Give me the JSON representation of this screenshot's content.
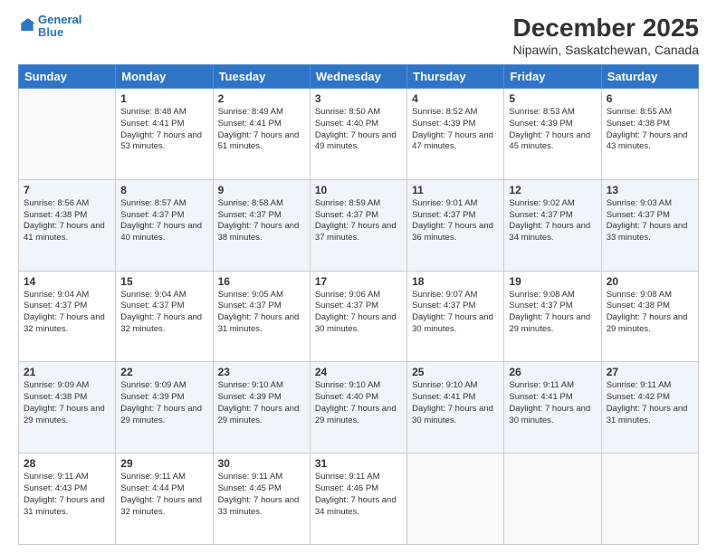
{
  "header": {
    "logo_line1": "General",
    "logo_line2": "Blue",
    "title": "December 2025",
    "subtitle": "Nipawin, Saskatchewan, Canada"
  },
  "weekdays": [
    "Sunday",
    "Monday",
    "Tuesday",
    "Wednesday",
    "Thursday",
    "Friday",
    "Saturday"
  ],
  "weeks": [
    [
      {
        "day": "",
        "sunrise": "",
        "sunset": "",
        "daylight": ""
      },
      {
        "day": "1",
        "sunrise": "Sunrise: 8:48 AM",
        "sunset": "Sunset: 4:41 PM",
        "daylight": "Daylight: 7 hours and 53 minutes."
      },
      {
        "day": "2",
        "sunrise": "Sunrise: 8:49 AM",
        "sunset": "Sunset: 4:41 PM",
        "daylight": "Daylight: 7 hours and 51 minutes."
      },
      {
        "day": "3",
        "sunrise": "Sunrise: 8:50 AM",
        "sunset": "Sunset: 4:40 PM",
        "daylight": "Daylight: 7 hours and 49 minutes."
      },
      {
        "day": "4",
        "sunrise": "Sunrise: 8:52 AM",
        "sunset": "Sunset: 4:39 PM",
        "daylight": "Daylight: 7 hours and 47 minutes."
      },
      {
        "day": "5",
        "sunrise": "Sunrise: 8:53 AM",
        "sunset": "Sunset: 4:39 PM",
        "daylight": "Daylight: 7 hours and 45 minutes."
      },
      {
        "day": "6",
        "sunrise": "Sunrise: 8:55 AM",
        "sunset": "Sunset: 4:38 PM",
        "daylight": "Daylight: 7 hours and 43 minutes."
      }
    ],
    [
      {
        "day": "7",
        "sunrise": "Sunrise: 8:56 AM",
        "sunset": "Sunset: 4:38 PM",
        "daylight": "Daylight: 7 hours and 41 minutes."
      },
      {
        "day": "8",
        "sunrise": "Sunrise: 8:57 AM",
        "sunset": "Sunset: 4:37 PM",
        "daylight": "Daylight: 7 hours and 40 minutes."
      },
      {
        "day": "9",
        "sunrise": "Sunrise: 8:58 AM",
        "sunset": "Sunset: 4:37 PM",
        "daylight": "Daylight: 7 hours and 38 minutes."
      },
      {
        "day": "10",
        "sunrise": "Sunrise: 8:59 AM",
        "sunset": "Sunset: 4:37 PM",
        "daylight": "Daylight: 7 hours and 37 minutes."
      },
      {
        "day": "11",
        "sunrise": "Sunrise: 9:01 AM",
        "sunset": "Sunset: 4:37 PM",
        "daylight": "Daylight: 7 hours and 36 minutes."
      },
      {
        "day": "12",
        "sunrise": "Sunrise: 9:02 AM",
        "sunset": "Sunset: 4:37 PM",
        "daylight": "Daylight: 7 hours and 34 minutes."
      },
      {
        "day": "13",
        "sunrise": "Sunrise: 9:03 AM",
        "sunset": "Sunset: 4:37 PM",
        "daylight": "Daylight: 7 hours and 33 minutes."
      }
    ],
    [
      {
        "day": "14",
        "sunrise": "Sunrise: 9:04 AM",
        "sunset": "Sunset: 4:37 PM",
        "daylight": "Daylight: 7 hours and 32 minutes."
      },
      {
        "day": "15",
        "sunrise": "Sunrise: 9:04 AM",
        "sunset": "Sunset: 4:37 PM",
        "daylight": "Daylight: 7 hours and 32 minutes."
      },
      {
        "day": "16",
        "sunrise": "Sunrise: 9:05 AM",
        "sunset": "Sunset: 4:37 PM",
        "daylight": "Daylight: 7 hours and 31 minutes."
      },
      {
        "day": "17",
        "sunrise": "Sunrise: 9:06 AM",
        "sunset": "Sunset: 4:37 PM",
        "daylight": "Daylight: 7 hours and 30 minutes."
      },
      {
        "day": "18",
        "sunrise": "Sunrise: 9:07 AM",
        "sunset": "Sunset: 4:37 PM",
        "daylight": "Daylight: 7 hours and 30 minutes."
      },
      {
        "day": "19",
        "sunrise": "Sunrise: 9:08 AM",
        "sunset": "Sunset: 4:37 PM",
        "daylight": "Daylight: 7 hours and 29 minutes."
      },
      {
        "day": "20",
        "sunrise": "Sunrise: 9:08 AM",
        "sunset": "Sunset: 4:38 PM",
        "daylight": "Daylight: 7 hours and 29 minutes."
      }
    ],
    [
      {
        "day": "21",
        "sunrise": "Sunrise: 9:09 AM",
        "sunset": "Sunset: 4:38 PM",
        "daylight": "Daylight: 7 hours and 29 minutes."
      },
      {
        "day": "22",
        "sunrise": "Sunrise: 9:09 AM",
        "sunset": "Sunset: 4:39 PM",
        "daylight": "Daylight: 7 hours and 29 minutes."
      },
      {
        "day": "23",
        "sunrise": "Sunrise: 9:10 AM",
        "sunset": "Sunset: 4:39 PM",
        "daylight": "Daylight: 7 hours and 29 minutes."
      },
      {
        "day": "24",
        "sunrise": "Sunrise: 9:10 AM",
        "sunset": "Sunset: 4:40 PM",
        "daylight": "Daylight: 7 hours and 29 minutes."
      },
      {
        "day": "25",
        "sunrise": "Sunrise: 9:10 AM",
        "sunset": "Sunset: 4:41 PM",
        "daylight": "Daylight: 7 hours and 30 minutes."
      },
      {
        "day": "26",
        "sunrise": "Sunrise: 9:11 AM",
        "sunset": "Sunset: 4:41 PM",
        "daylight": "Daylight: 7 hours and 30 minutes."
      },
      {
        "day": "27",
        "sunrise": "Sunrise: 9:11 AM",
        "sunset": "Sunset: 4:42 PM",
        "daylight": "Daylight: 7 hours and 31 minutes."
      }
    ],
    [
      {
        "day": "28",
        "sunrise": "Sunrise: 9:11 AM",
        "sunset": "Sunset: 4:43 PM",
        "daylight": "Daylight: 7 hours and 31 minutes."
      },
      {
        "day": "29",
        "sunrise": "Sunrise: 9:11 AM",
        "sunset": "Sunset: 4:44 PM",
        "daylight": "Daylight: 7 hours and 32 minutes."
      },
      {
        "day": "30",
        "sunrise": "Sunrise: 9:11 AM",
        "sunset": "Sunset: 4:45 PM",
        "daylight": "Daylight: 7 hours and 33 minutes."
      },
      {
        "day": "31",
        "sunrise": "Sunrise: 9:11 AM",
        "sunset": "Sunset: 4:46 PM",
        "daylight": "Daylight: 7 hours and 34 minutes."
      },
      {
        "day": "",
        "sunrise": "",
        "sunset": "",
        "daylight": ""
      },
      {
        "day": "",
        "sunrise": "",
        "sunset": "",
        "daylight": ""
      },
      {
        "day": "",
        "sunrise": "",
        "sunset": "",
        "daylight": ""
      }
    ]
  ]
}
